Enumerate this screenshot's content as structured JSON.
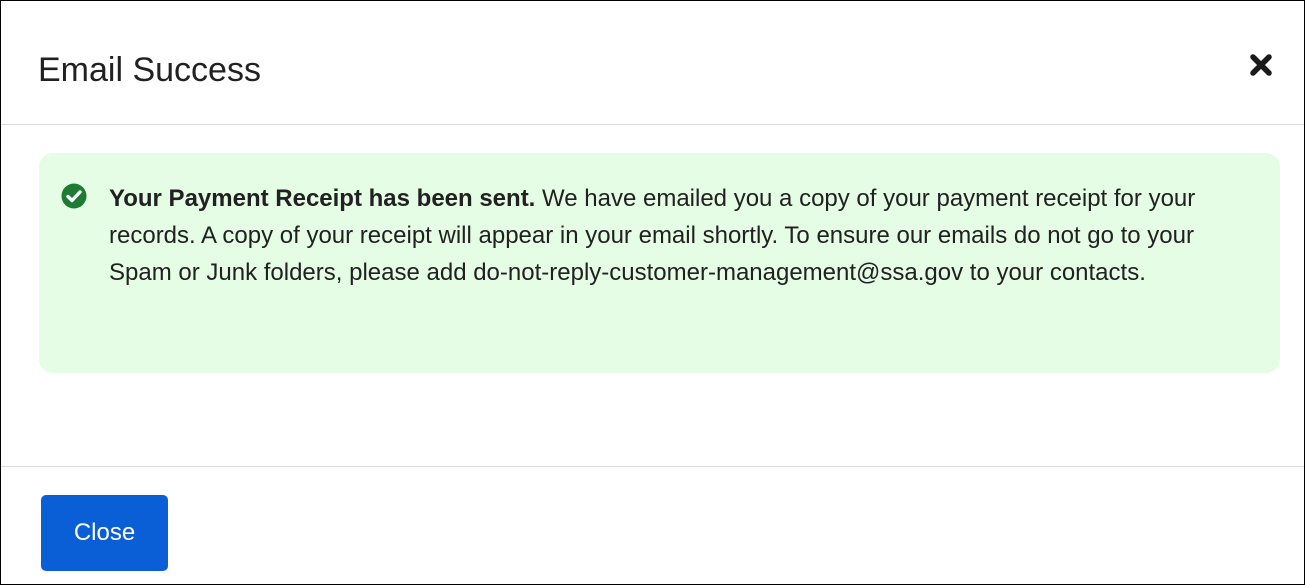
{
  "modal": {
    "title": "Email Success",
    "close_icon": "close-x-icon"
  },
  "alert": {
    "icon": "check-circle-icon",
    "bold_text": "Your Payment Receipt has been sent.",
    "body_text": " We have emailed you a copy of your payment receipt for your records. A copy of your receipt will appear in your email shortly. To ensure our emails do not go to your Spam or Junk folders, please add do-not-reply-customer-management@ssa.gov to your contacts."
  },
  "footer": {
    "close_label": "Close"
  },
  "colors": {
    "alert_background": "#e5fde5",
    "success_icon": "#1e7b34",
    "primary_button": "#0b5fd6"
  }
}
